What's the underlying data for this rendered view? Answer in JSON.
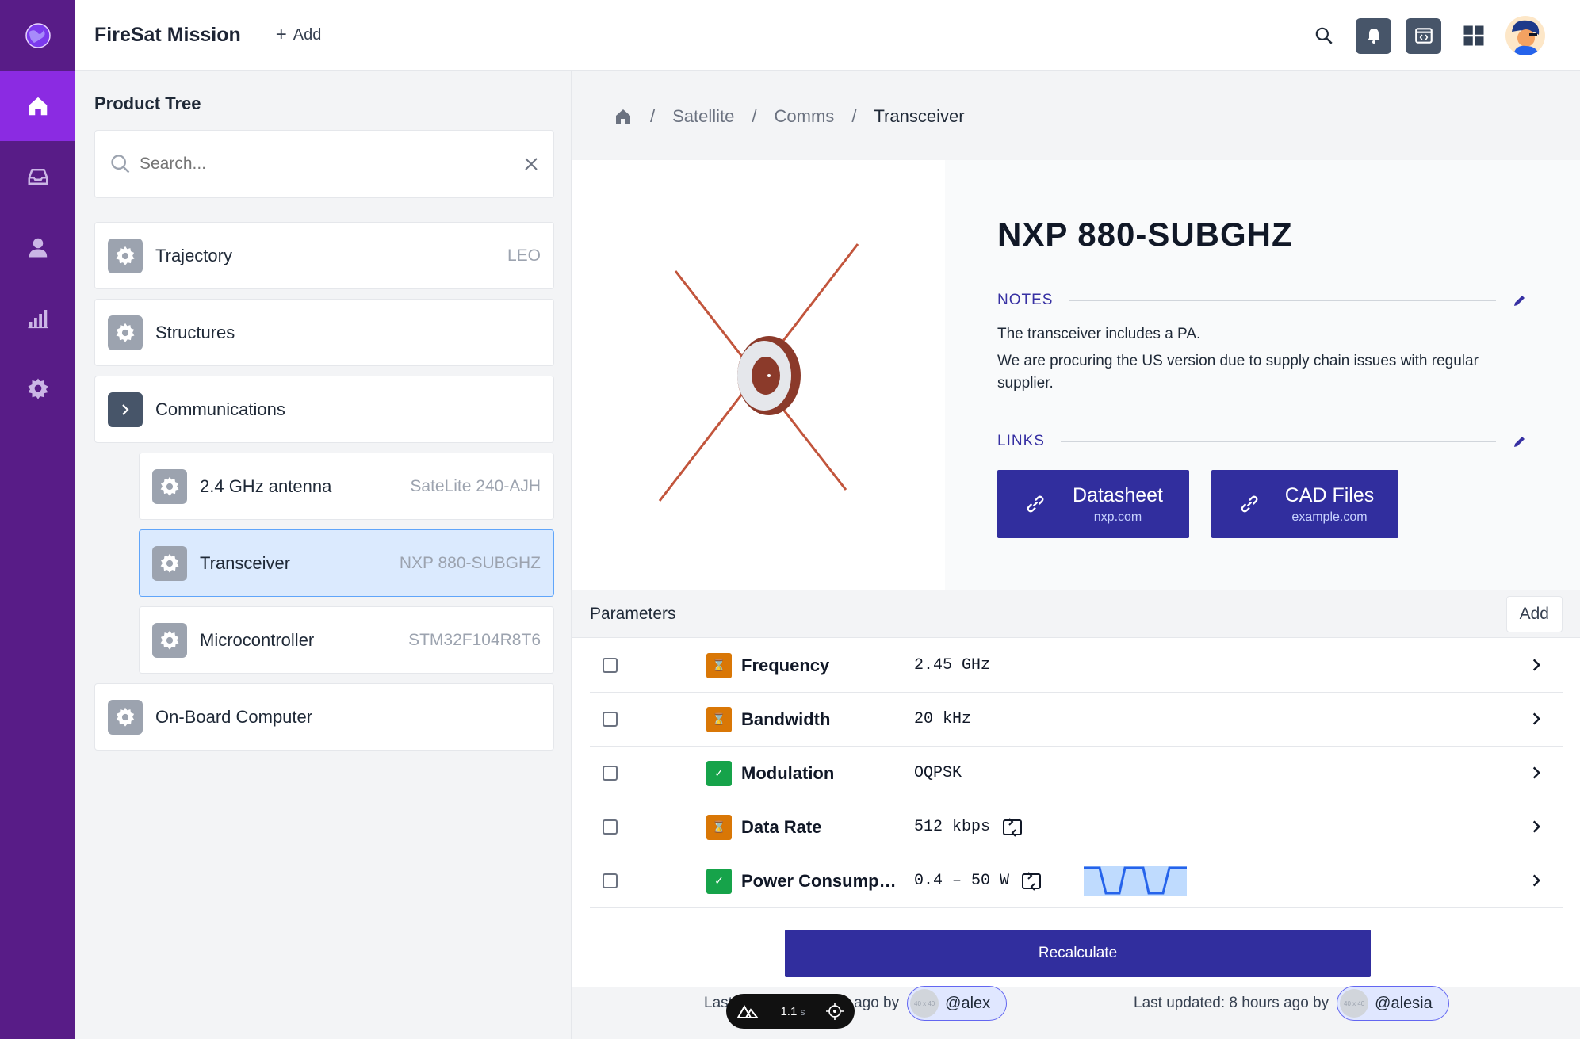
{
  "app": {
    "title": "FireSat Mission",
    "add_label": "Add"
  },
  "sidebar": {
    "items": [
      {
        "icon": "home-icon",
        "active": true
      },
      {
        "icon": "inbox-icon",
        "active": false
      },
      {
        "icon": "user-icon",
        "active": false
      },
      {
        "icon": "chart-icon",
        "active": false
      },
      {
        "icon": "gear-icon",
        "active": false
      }
    ]
  },
  "product_tree": {
    "title": "Product Tree",
    "search_placeholder": "Search...",
    "items": [
      {
        "label": "Trajectory",
        "meta": "LEO"
      },
      {
        "label": "Structures",
        "meta": ""
      },
      {
        "label": "Communications",
        "meta": "",
        "expanded": true
      },
      {
        "label": "2.4 GHz antenna",
        "meta": "SateLite 240-AJH"
      },
      {
        "label": "Transceiver",
        "meta": "NXP 880-SUBGHZ",
        "selected": true
      },
      {
        "label": "Microcontroller",
        "meta": "STM32F104R8T6"
      },
      {
        "label": "On-Board Computer",
        "meta": ""
      }
    ]
  },
  "breadcrumb": {
    "items": [
      "Satellite",
      "Comms"
    ],
    "current": "Transceiver"
  },
  "component": {
    "name": "NXP 880-SUBGHZ",
    "notes_label": "NOTES",
    "notes": [
      "The transceiver includes a PA.",
      "We are procuring the US version due to supply chain issues with regular supplier."
    ],
    "links_label": "LINKS",
    "links": [
      {
        "title": "Datasheet",
        "domain": "nxp.com"
      },
      {
        "title": "CAD Files",
        "domain": "example.com"
      }
    ]
  },
  "parameters": {
    "title": "Parameters",
    "add_label": "Add",
    "rows": [
      {
        "name": "Frequency",
        "value": "2.45 GHz",
        "status": "pending"
      },
      {
        "name": "Bandwidth",
        "value": "20 kHz",
        "status": "pending"
      },
      {
        "name": "Modulation",
        "value": "OQPSK",
        "status": "ok"
      },
      {
        "name": "Data Rate",
        "value": "512 kbps",
        "status": "pending",
        "linked": true
      },
      {
        "name": "Power Consumpti…",
        "value": "0.4 – 50 W",
        "status": "ok",
        "linked": true,
        "sparkline": true
      }
    ]
  },
  "recalculate_label": "Recalculate",
  "updates": [
    {
      "text": "Last updated: 8 hours ago by",
      "user": "@alex"
    },
    {
      "text": "Last updated: 8 hours ago by",
      "user": "@alesia"
    }
  ],
  "toast": {
    "time": "1.1",
    "unit": "s"
  },
  "colors": {
    "sidebar": "#581c87",
    "accent": "#312e9e",
    "active_nav": "#8b2be2",
    "pending": "#d97706",
    "ok": "#16a34a"
  }
}
